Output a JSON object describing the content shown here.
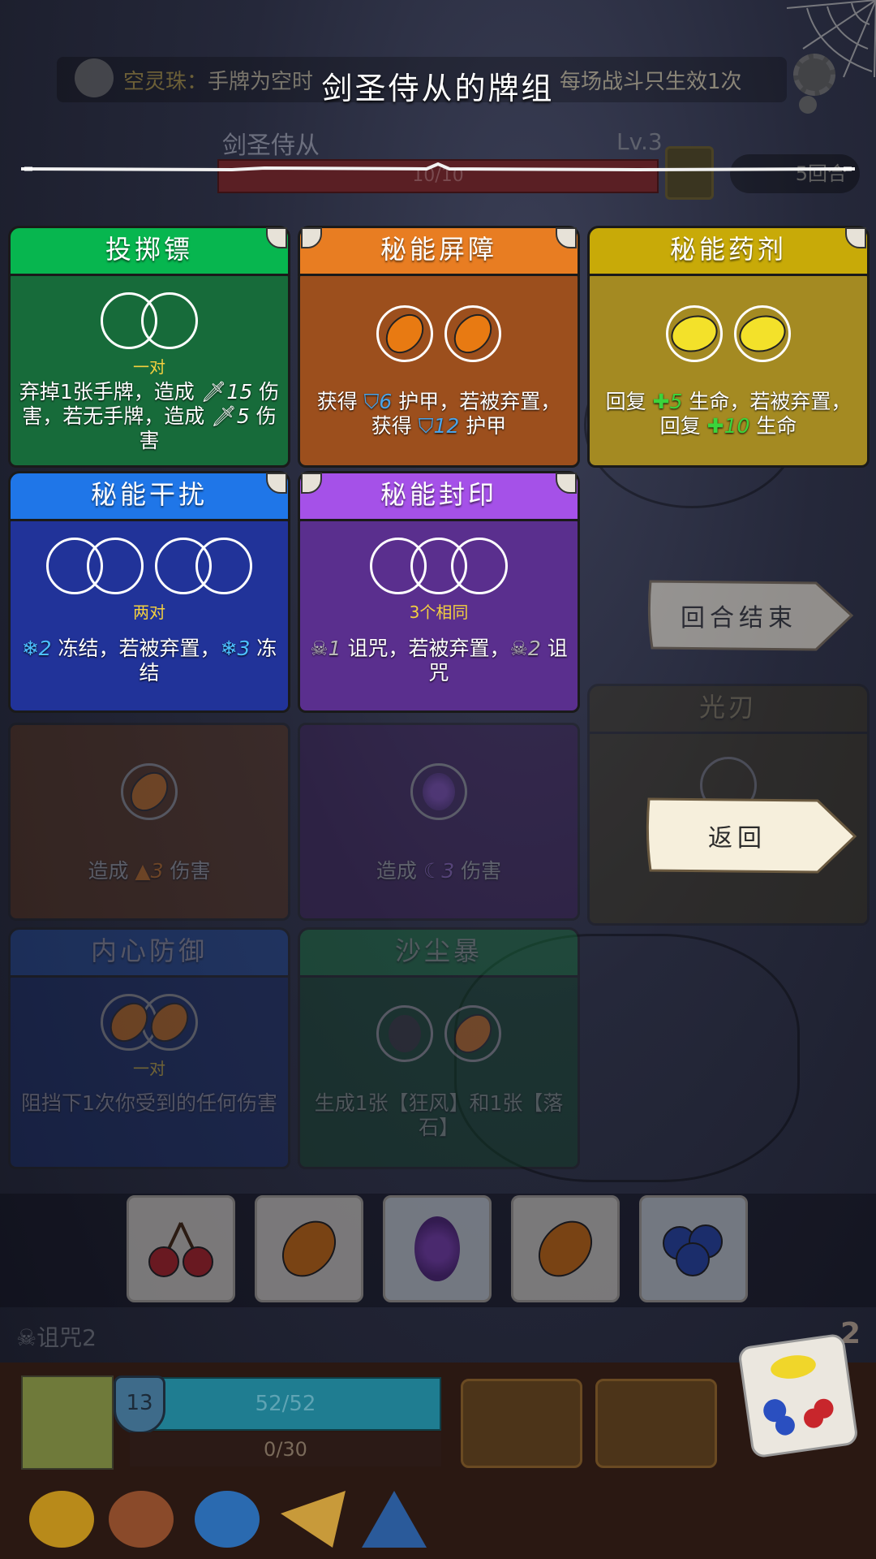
{
  "header": {
    "title": "剑圣侍从的牌组",
    "spirit_label": "空灵珠：",
    "spirit_text": "手牌为空时",
    "spirit_text_end": "每场战斗只生效1次"
  },
  "enemy": {
    "name": "剑圣侍从",
    "level": "Lv.3",
    "hp": "10/10",
    "rounds": "5回合"
  },
  "cards": [
    {
      "name": "投掷镖",
      "requirement": "一对",
      "desc_a": "弃掉1张手牌，造成 ",
      "val1": "15",
      "desc_b": " 伤害，若无手牌，造成 ",
      "val2": "5",
      "desc_c": " 伤害",
      "color": "#00b24e"
    },
    {
      "name": "秘能屏障",
      "desc_a": "获得 ",
      "val1": "6",
      "desc_b": " 护甲，若被弃置，获得 ",
      "val2": "12",
      "desc_c": " 护甲",
      "color": "#e57b1f"
    },
    {
      "name": "秘能药剂",
      "desc_a": "回复 ",
      "val1": "5",
      "desc_b": " 生命，若被弃置，回复 ",
      "val2": "10",
      "desc_c": " 生命",
      "color": "#c7a805"
    },
    {
      "name": "秘能干扰",
      "requirement": "两对",
      "val1": "2",
      "desc_b": " 冻结，若被弃置，",
      "val2": "3",
      "desc_c": " 冻结",
      "color": "#1f74e6"
    },
    {
      "name": "秘能封印",
      "requirement": "3个相同",
      "val1": "1",
      "desc_b": " 诅咒，若被弃置，",
      "val2": "2",
      "desc_c": " 诅咒",
      "color": "#a654e6"
    },
    {
      "name": "光刃"
    },
    {
      "desc_a": "造成 ",
      "val1": "3",
      "desc_b": " 伤害"
    },
    {
      "desc_a": "造成 ",
      "val1": "3",
      "desc_b": " 伤害"
    },
    {
      "name": "内心防御",
      "requirement": "一对",
      "desc_a": "阻挡下1次你受到的任何伤害"
    },
    {
      "name": "沙尘暴",
      "desc_a": "生成1张【狂风】和1张【落石】"
    }
  ],
  "buttons": {
    "end_turn": "回合结束",
    "back": "返回"
  },
  "player": {
    "curse": "诅咒2",
    "armor": "13",
    "hp": "52/52",
    "mana": "0/30",
    "dice_count": "2"
  }
}
